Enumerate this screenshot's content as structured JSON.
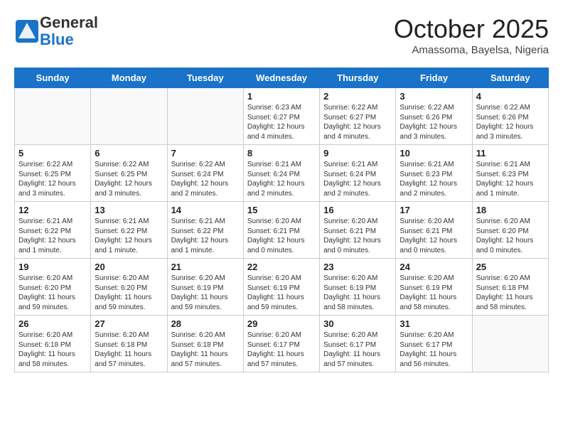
{
  "header": {
    "logo_line1": "General",
    "logo_line2": "Blue",
    "month": "October 2025",
    "location": "Amassoma, Bayelsa, Nigeria"
  },
  "weekdays": [
    "Sunday",
    "Monday",
    "Tuesday",
    "Wednesday",
    "Thursday",
    "Friday",
    "Saturday"
  ],
  "weeks": [
    [
      {
        "day": "",
        "info": ""
      },
      {
        "day": "",
        "info": ""
      },
      {
        "day": "",
        "info": ""
      },
      {
        "day": "1",
        "info": "Sunrise: 6:23 AM\nSunset: 6:27 PM\nDaylight: 12 hours\nand 4 minutes."
      },
      {
        "day": "2",
        "info": "Sunrise: 6:22 AM\nSunset: 6:27 PM\nDaylight: 12 hours\nand 4 minutes."
      },
      {
        "day": "3",
        "info": "Sunrise: 6:22 AM\nSunset: 6:26 PM\nDaylight: 12 hours\nand 3 minutes."
      },
      {
        "day": "4",
        "info": "Sunrise: 6:22 AM\nSunset: 6:26 PM\nDaylight: 12 hours\nand 3 minutes."
      }
    ],
    [
      {
        "day": "5",
        "info": "Sunrise: 6:22 AM\nSunset: 6:25 PM\nDaylight: 12 hours\nand 3 minutes."
      },
      {
        "day": "6",
        "info": "Sunrise: 6:22 AM\nSunset: 6:25 PM\nDaylight: 12 hours\nand 3 minutes."
      },
      {
        "day": "7",
        "info": "Sunrise: 6:22 AM\nSunset: 6:24 PM\nDaylight: 12 hours\nand 2 minutes."
      },
      {
        "day": "8",
        "info": "Sunrise: 6:21 AM\nSunset: 6:24 PM\nDaylight: 12 hours\nand 2 minutes."
      },
      {
        "day": "9",
        "info": "Sunrise: 6:21 AM\nSunset: 6:24 PM\nDaylight: 12 hours\nand 2 minutes."
      },
      {
        "day": "10",
        "info": "Sunrise: 6:21 AM\nSunset: 6:23 PM\nDaylight: 12 hours\nand 2 minutes."
      },
      {
        "day": "11",
        "info": "Sunrise: 6:21 AM\nSunset: 6:23 PM\nDaylight: 12 hours\nand 1 minute."
      }
    ],
    [
      {
        "day": "12",
        "info": "Sunrise: 6:21 AM\nSunset: 6:22 PM\nDaylight: 12 hours\nand 1 minute."
      },
      {
        "day": "13",
        "info": "Sunrise: 6:21 AM\nSunset: 6:22 PM\nDaylight: 12 hours\nand 1 minute."
      },
      {
        "day": "14",
        "info": "Sunrise: 6:21 AM\nSunset: 6:22 PM\nDaylight: 12 hours\nand 1 minute."
      },
      {
        "day": "15",
        "info": "Sunrise: 6:20 AM\nSunset: 6:21 PM\nDaylight: 12 hours\nand 0 minutes."
      },
      {
        "day": "16",
        "info": "Sunrise: 6:20 AM\nSunset: 6:21 PM\nDaylight: 12 hours\nand 0 minutes."
      },
      {
        "day": "17",
        "info": "Sunrise: 6:20 AM\nSunset: 6:21 PM\nDaylight: 12 hours\nand 0 minutes."
      },
      {
        "day": "18",
        "info": "Sunrise: 6:20 AM\nSunset: 6:20 PM\nDaylight: 12 hours\nand 0 minutes."
      }
    ],
    [
      {
        "day": "19",
        "info": "Sunrise: 6:20 AM\nSunset: 6:20 PM\nDaylight: 11 hours\nand 59 minutes."
      },
      {
        "day": "20",
        "info": "Sunrise: 6:20 AM\nSunset: 6:20 PM\nDaylight: 11 hours\nand 59 minutes."
      },
      {
        "day": "21",
        "info": "Sunrise: 6:20 AM\nSunset: 6:19 PM\nDaylight: 11 hours\nand 59 minutes."
      },
      {
        "day": "22",
        "info": "Sunrise: 6:20 AM\nSunset: 6:19 PM\nDaylight: 11 hours\nand 59 minutes."
      },
      {
        "day": "23",
        "info": "Sunrise: 6:20 AM\nSunset: 6:19 PM\nDaylight: 11 hours\nand 58 minutes."
      },
      {
        "day": "24",
        "info": "Sunrise: 6:20 AM\nSunset: 6:19 PM\nDaylight: 11 hours\nand 58 minutes."
      },
      {
        "day": "25",
        "info": "Sunrise: 6:20 AM\nSunset: 6:18 PM\nDaylight: 11 hours\nand 58 minutes."
      }
    ],
    [
      {
        "day": "26",
        "info": "Sunrise: 6:20 AM\nSunset: 6:18 PM\nDaylight: 11 hours\nand 58 minutes."
      },
      {
        "day": "27",
        "info": "Sunrise: 6:20 AM\nSunset: 6:18 PM\nDaylight: 11 hours\nand 57 minutes."
      },
      {
        "day": "28",
        "info": "Sunrise: 6:20 AM\nSunset: 6:18 PM\nDaylight: 11 hours\nand 57 minutes."
      },
      {
        "day": "29",
        "info": "Sunrise: 6:20 AM\nSunset: 6:17 PM\nDaylight: 11 hours\nand 57 minutes."
      },
      {
        "day": "30",
        "info": "Sunrise: 6:20 AM\nSunset: 6:17 PM\nDaylight: 11 hours\nand 57 minutes."
      },
      {
        "day": "31",
        "info": "Sunrise: 6:20 AM\nSunset: 6:17 PM\nDaylight: 11 hours\nand 56 minutes."
      },
      {
        "day": "",
        "info": ""
      }
    ]
  ]
}
